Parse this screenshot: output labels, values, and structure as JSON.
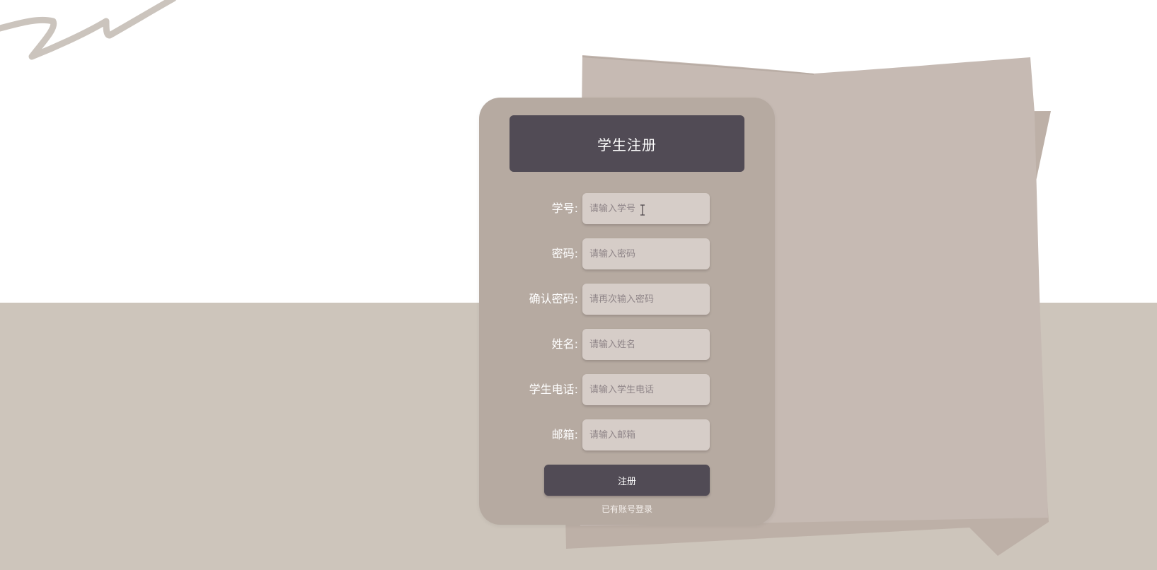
{
  "form": {
    "title": "学生注册",
    "fields": [
      {
        "label": "学号:",
        "placeholder": "请输入学号",
        "value": ""
      },
      {
        "label": "密码:",
        "placeholder": "请输入密码",
        "value": ""
      },
      {
        "label": "确认密码:",
        "placeholder": "请再次输入密码",
        "value": ""
      },
      {
        "label": "姓名:",
        "placeholder": "请输入姓名",
        "value": ""
      },
      {
        "label": "学生电话:",
        "placeholder": "请输入学生电话",
        "value": ""
      },
      {
        "label": "邮箱:",
        "placeholder": "请输入邮箱",
        "value": ""
      }
    ],
    "submit_label": "注册",
    "login_link": "已有账号登录"
  },
  "colors": {
    "card_bg": "#b6aaa1",
    "header_bg": "#514b55",
    "floor": "#cdc5bb",
    "input_bg": "#d6cdc8",
    "paper": "#c6bab3"
  },
  "icons": [
    "text-cursor-icon"
  ]
}
